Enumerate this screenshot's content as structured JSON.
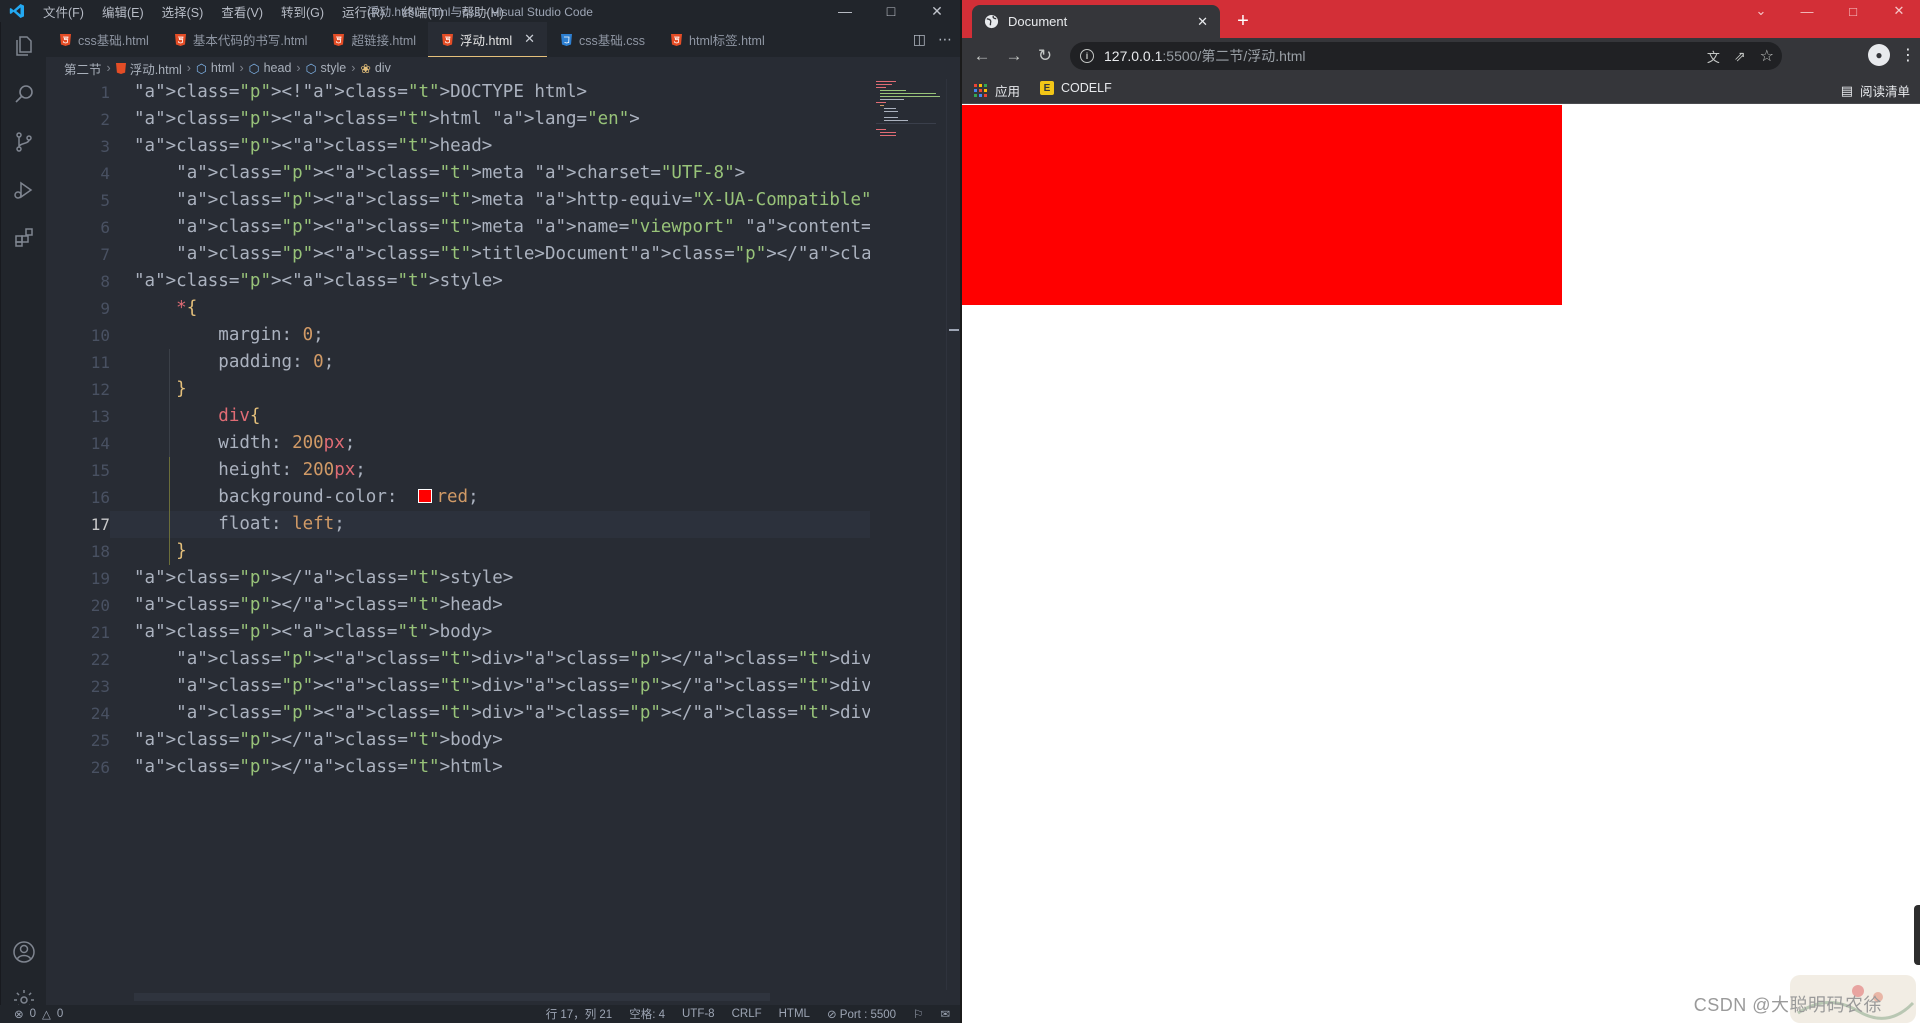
{
  "vscode": {
    "menu": [
      "文件(F)",
      "编辑(E)",
      "选择(S)",
      "查看(V)",
      "转到(G)",
      "运行(R)",
      "终端(T)",
      "帮助(H)"
    ],
    "window_title": "浮动.html - html与css - Visual Studio Code",
    "tabs": [
      {
        "label": "css基础.html",
        "type": "html"
      },
      {
        "label": "基本代码的书写.html",
        "type": "html"
      },
      {
        "label": "超链接.html",
        "type": "html"
      },
      {
        "label": "浮动.html",
        "type": "html",
        "active": true
      },
      {
        "label": "css基础.css",
        "type": "css"
      },
      {
        "label": "html标签.html",
        "type": "html"
      }
    ],
    "breadcrumb": [
      "第二节",
      "浮动.html",
      "html",
      "head",
      "style",
      "div"
    ],
    "current_line": 17,
    "code_lines": [
      "<!DOCTYPE html>",
      "<html lang=\"en\">",
      "<head>",
      "    <meta charset=\"UTF-8\">",
      "    <meta http-equiv=\"X-UA-Compatible\" content=\"IE=edge\">",
      "    <meta name=\"viewport\" content=\"width=device-width, initial-scal",
      "    <title>Document</title>",
      "<style>",
      "    *{",
      "        margin: 0;",
      "        padding: 0;",
      "    }",
      "        div{",
      "        width: 200px;",
      "        height: 200px;",
      "        background-color:  red;",
      "        float: left;",
      "    }",
      "</style>",
      "</head>",
      "<body>",
      "    <div></div>",
      "    <div></div>",
      "    <div></div>",
      "</body>",
      "</html>"
    ],
    "status": {
      "errors": "0",
      "warnings": "0",
      "position": "行 17，列 21",
      "spaces": "空格: 4",
      "encoding": "UTF-8",
      "eol": "CRLF",
      "language": "HTML",
      "port": "Port : 5500"
    }
  },
  "chrome": {
    "tab_title": "Document",
    "url_host": "127.0.0.1",
    "url_path": ":5500/第二节/浮动.html",
    "bookmarks": [
      "应用",
      "CODELF"
    ],
    "reading_list": "阅读清单",
    "page_bg": "#ffffff",
    "div_color": "#ff0000"
  },
  "watermark": "CSDN @大聪明码农徐"
}
